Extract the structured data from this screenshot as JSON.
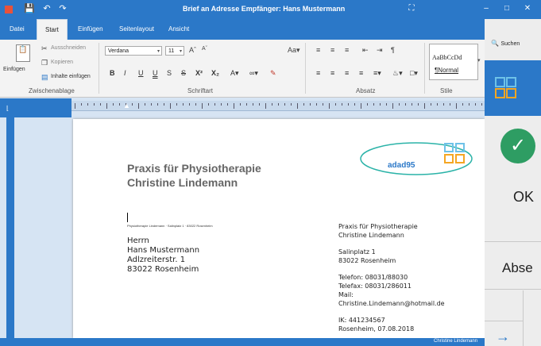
{
  "window": {
    "title": "Brief an Adresse Empfänger: Hans Mustermann"
  },
  "tabs": [
    "Datei",
    "Start",
    "Einfügen",
    "Seitenlayout",
    "Ansicht"
  ],
  "ribbon": {
    "clipboard": {
      "group_label": "Zwischenablage",
      "paste": "Einfügen",
      "cut": "Ausschneiden",
      "copy": "Kopieren",
      "paste_content": "Inhalte einfügen"
    },
    "font": {
      "group_label": "Schriftart",
      "font_name": "Verdana",
      "font_size": "11"
    },
    "paragraph": {
      "group_label": "Absatz"
    },
    "styles": {
      "group_label": "Stile",
      "preview": "AaBbCcDd",
      "current": "¶Normal"
    },
    "search": {
      "label": "Suchen"
    }
  },
  "document": {
    "logo_text": "adad95",
    "heading_line1": "Praxis für Physiotherapie",
    "heading_line2": "Christine Lindemann",
    "sender_line": "Physiotherapie Lindemann · Salinplatz 1 · 83022 Rosenheim",
    "recipient": [
      "Herrn",
      "Hans Mustermann",
      "Adlzreiterstr. 1",
      "83022 Rosenheim"
    ],
    "sender_block": {
      "name1": "Praxis für Physiotherapie",
      "name2": "Christine Lindemann",
      "street": "Salinplatz 1",
      "city": "83022 Rosenheim",
      "phone": "Telefon: 08031/88030",
      "fax": "Telefax: 08031/286011",
      "mail_label": "Mail:",
      "mail": "Christine.Lindemann@hotmail.de",
      "ik": "IK: 441234567",
      "date": "Rosenheim, 07.08.2018"
    }
  },
  "status": {
    "user": "Christine Lindemann"
  },
  "side_panel": {
    "ok_label": "OK",
    "abs_label": "Abse"
  },
  "colors": {
    "accent": "#2b78c8",
    "check": "#2e9d63",
    "heading": "#666666"
  }
}
